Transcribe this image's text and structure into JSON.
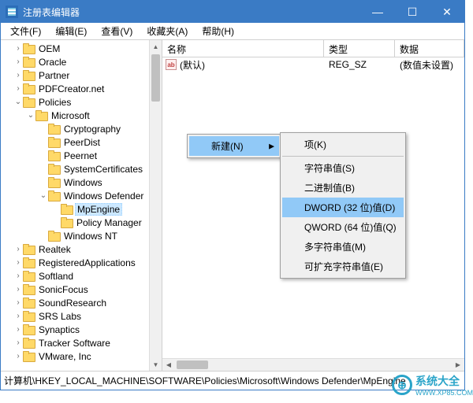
{
  "window": {
    "title": "注册表编辑器"
  },
  "menubar": [
    "文件(F)",
    "编辑(E)",
    "查看(V)",
    "收藏夹(A)",
    "帮助(H)"
  ],
  "tree": [
    {
      "d": 1,
      "exp": ">",
      "label": "OEM"
    },
    {
      "d": 1,
      "exp": ">",
      "label": "Oracle"
    },
    {
      "d": 1,
      "exp": ">",
      "label": "Partner"
    },
    {
      "d": 1,
      "exp": ">",
      "label": "PDFCreator.net"
    },
    {
      "d": 1,
      "exp": "v",
      "label": "Policies"
    },
    {
      "d": 2,
      "exp": "v",
      "label": "Microsoft"
    },
    {
      "d": 3,
      "exp": " ",
      "label": "Cryptography"
    },
    {
      "d": 3,
      "exp": " ",
      "label": "PeerDist"
    },
    {
      "d": 3,
      "exp": " ",
      "label": "Peernet"
    },
    {
      "d": 3,
      "exp": " ",
      "label": "SystemCertificates"
    },
    {
      "d": 3,
      "exp": " ",
      "label": "Windows"
    },
    {
      "d": 3,
      "exp": "v",
      "label": "Windows Defender"
    },
    {
      "d": 4,
      "exp": " ",
      "label": "MpEngine",
      "selected": true
    },
    {
      "d": 4,
      "exp": " ",
      "label": "Policy Manager"
    },
    {
      "d": 3,
      "exp": " ",
      "label": "Windows NT"
    },
    {
      "d": 1,
      "exp": ">",
      "label": "Realtek"
    },
    {
      "d": 1,
      "exp": ">",
      "label": "RegisteredApplications"
    },
    {
      "d": 1,
      "exp": ">",
      "label": "Softland"
    },
    {
      "d": 1,
      "exp": ">",
      "label": "SonicFocus"
    },
    {
      "d": 1,
      "exp": ">",
      "label": "SoundResearch"
    },
    {
      "d": 1,
      "exp": ">",
      "label": "SRS Labs"
    },
    {
      "d": 1,
      "exp": ">",
      "label": "Synaptics"
    },
    {
      "d": 1,
      "exp": ">",
      "label": "Tracker Software"
    },
    {
      "d": 1,
      "exp": ">",
      "label": "VMware, Inc"
    }
  ],
  "columns": {
    "name": "名称",
    "type": "类型",
    "data": "数据"
  },
  "row": {
    "icon": "ab",
    "name": "(默认)",
    "type": "REG_SZ",
    "data": "(数值未设置)"
  },
  "context": {
    "main": {
      "label": "新建(N)"
    },
    "sub": [
      {
        "label": "项(K)"
      },
      {
        "label": "字符串值(S)"
      },
      {
        "label": "二进制值(B)"
      },
      {
        "label": "DWORD (32 位)值(D)",
        "hi": true
      },
      {
        "label": "QWORD (64 位)值(Q)"
      },
      {
        "label": "多字符串值(M)"
      },
      {
        "label": "可扩充字符串值(E)"
      }
    ]
  },
  "statusbar": "计算机\\HKEY_LOCAL_MACHINE\\SOFTWARE\\Policies\\Microsoft\\Windows Defender\\MpEngine",
  "watermark": {
    "brand": "系统大全",
    "url": "WWW.XP85.COM",
    "symbol": "⊕"
  }
}
